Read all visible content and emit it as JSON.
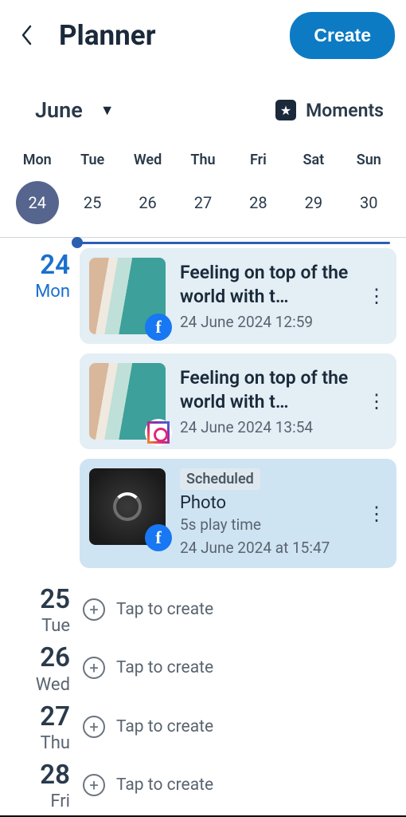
{
  "header": {
    "title": "Planner",
    "create_label": "Create"
  },
  "subheader": {
    "month": "June",
    "moments_label": "Moments"
  },
  "week": {
    "days_of_week": [
      "Mon",
      "Tue",
      "Wed",
      "Thu",
      "Fri",
      "Sat",
      "Sun"
    ],
    "dates": [
      "24",
      "25",
      "26",
      "27",
      "28",
      "29",
      "30"
    ],
    "selected_index": 0
  },
  "today": {
    "num": "24",
    "abbr": "Mon"
  },
  "posts": [
    {
      "title": "Feeling on top of the world with t…",
      "time": "24 June 2024 12:59",
      "platform": "fb"
    },
    {
      "title": "Feeling on top of the world with t…",
      "time": "24 June 2024 13:54",
      "platform": "ig"
    }
  ],
  "scheduled": {
    "tag": "Scheduled",
    "subtitle": "Photo",
    "meta1": "5s play time",
    "meta2": "24 June 2024 at 15:47",
    "platform": "fb"
  },
  "upcoming": [
    {
      "num": "25",
      "abbr": "Tue"
    },
    {
      "num": "26",
      "abbr": "Wed"
    },
    {
      "num": "27",
      "abbr": "Thu"
    },
    {
      "num": "28",
      "abbr": "Fri"
    }
  ],
  "tap_label": "Tap to create"
}
